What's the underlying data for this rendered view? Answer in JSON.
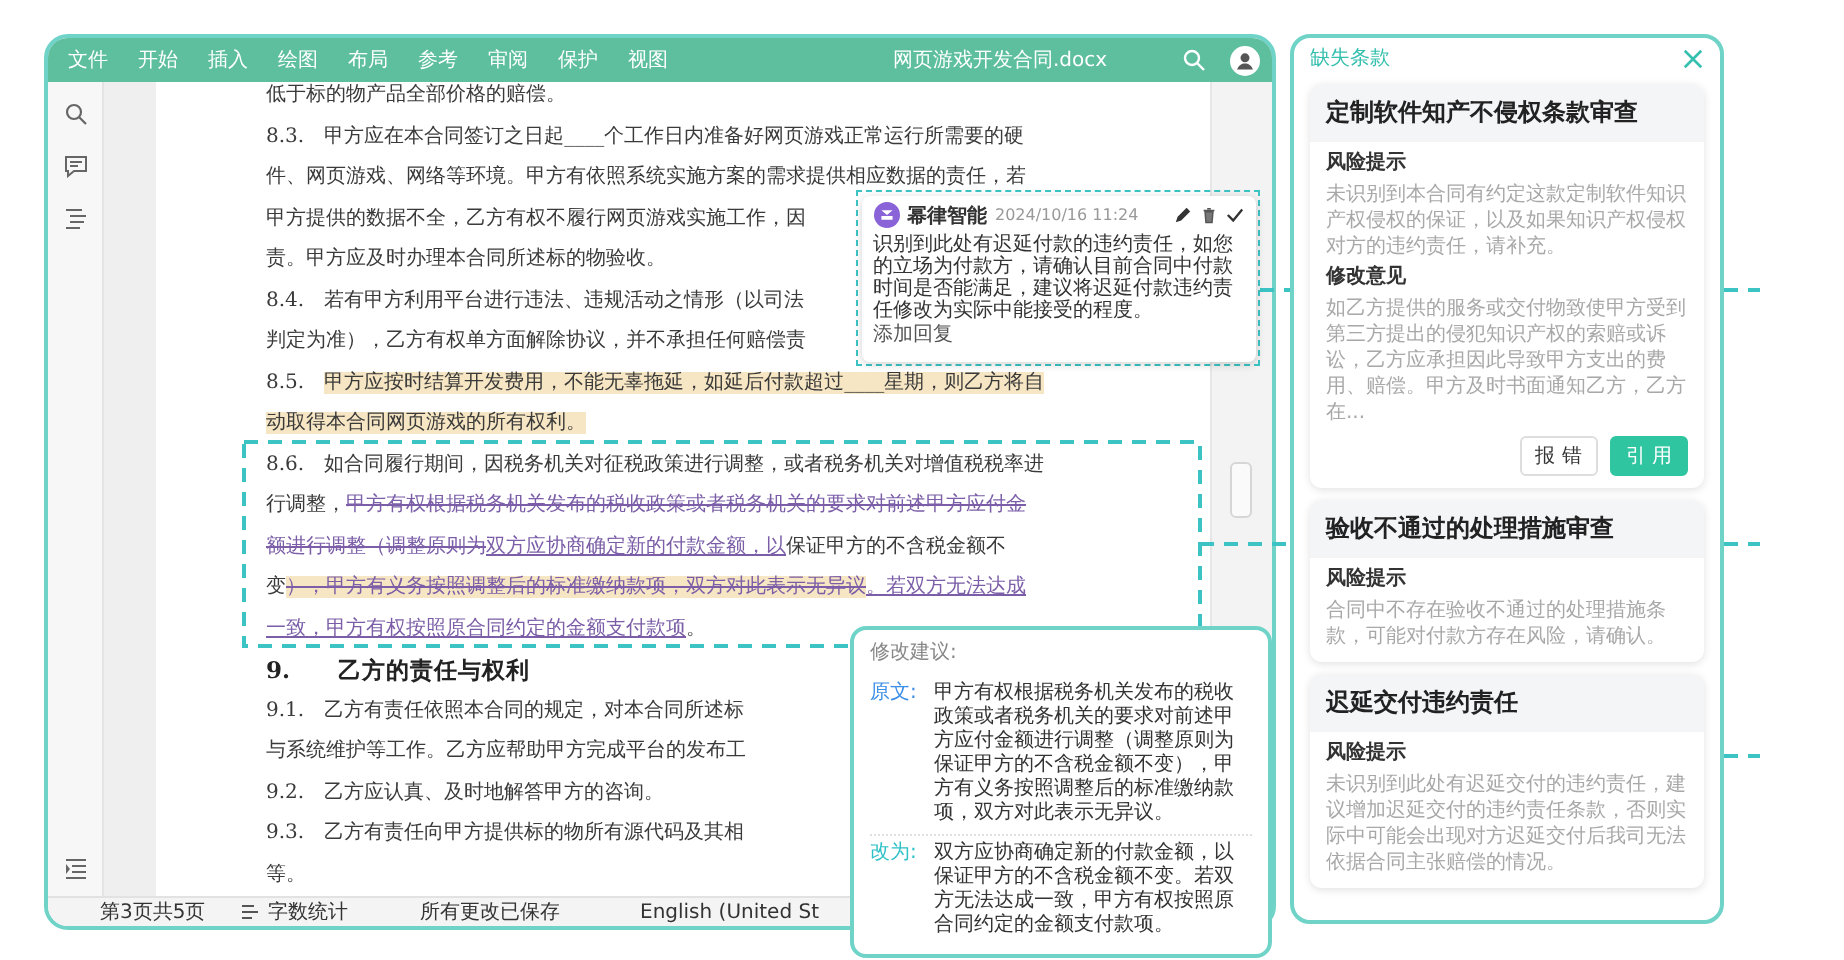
{
  "document_window": {
    "menu": [
      "文件",
      "开始",
      "插入",
      "绘图",
      "布局",
      "参考",
      "审阅",
      "保护",
      "视图"
    ],
    "title": "网页游戏开发合同.docx",
    "lines": [
      {
        "kind": "body",
        "segments": [
          {
            "text": "低于标的物产品全部价格的赔偿。",
            "kind": "plain",
            "highlighted": false
          }
        ]
      },
      {
        "kind": "body",
        "segments": [
          {
            "text": "8.3.　甲方应在本合同签订之日起____个工作日内准备好网页游戏正常运行所需要的硬",
            "kind": "plain",
            "highlighted": false
          }
        ]
      },
      {
        "kind": "body",
        "segments": [
          {
            "text": "件、网页游戏、网络等环境。甲方有依照系统实施方案的需求提供相应数据的责任，若",
            "kind": "plain",
            "highlighted": false
          }
        ]
      },
      {
        "kind": "body",
        "segments": [
          {
            "text": "甲方提供的数据不全，乙方有权不履行网页游戏实施工作，因",
            "kind": "plain",
            "highlighted": false
          }
        ]
      },
      {
        "kind": "body",
        "segments": [
          {
            "text": "责。甲方应及时办理本合同所述标的物验收。",
            "kind": "plain",
            "highlighted": false
          }
        ]
      },
      {
        "kind": "body",
        "segments": [
          {
            "text": "8.4.　若有甲方利用平台进行违法、违规活动之情形（以司法",
            "kind": "plain",
            "highlighted": false
          }
        ]
      },
      {
        "kind": "body",
        "segments": [
          {
            "text": "判定为准），乙方有权单方面解除协议，并不承担任何赔偿责",
            "kind": "plain",
            "highlighted": false
          }
        ]
      },
      {
        "kind": "body",
        "segments": [
          {
            "text": "8.5.　",
            "kind": "plain",
            "highlighted": false
          },
          {
            "text": "甲方应按时结算开发费用，不能无辜拖延，如延后付款超过____星期，则乙方将自",
            "kind": "plain",
            "highlighted": true
          }
        ]
      },
      {
        "kind": "body",
        "segments": [
          {
            "text": "动取得本合同网页游戏的所有权利。",
            "kind": "plain",
            "highlighted": true
          }
        ]
      },
      {
        "kind": "body",
        "segments": [
          {
            "text": "8.6.　如合同履行期间，因税务机关对征税政策进行调整，或者税务机关对增值税税率进",
            "kind": "plain",
            "highlighted": false
          }
        ]
      },
      {
        "kind": "body",
        "segments": [
          {
            "text": "行调整，",
            "kind": "plain",
            "highlighted": false
          },
          {
            "text": "甲方有权根据税务机关发布的税收政策或者税务机关的要求对前述甲方应付金",
            "kind": "deleted",
            "highlighted": false
          }
        ]
      },
      {
        "kind": "body",
        "segments": [
          {
            "text": "额进行调整（调整原则为",
            "kind": "deleted",
            "highlighted": false
          },
          {
            "text": "双方应协商确定新的付款金额，以",
            "kind": "inserted",
            "highlighted": false
          },
          {
            "text": "保证甲方的不含税金额不",
            "kind": "plain",
            "highlighted": false
          }
        ]
      },
      {
        "kind": "body",
        "segments": [
          {
            "text": "变",
            "kind": "plain",
            "highlighted": false
          },
          {
            "text": "），甲方有义务按照调整后的标准缴纳款项，双方对此表示无异议",
            "kind": "deleted",
            "highlighted": true
          },
          {
            "text": "。若双方无法达成",
            "kind": "inserted",
            "highlighted": false
          }
        ]
      },
      {
        "kind": "body",
        "segments": [
          {
            "text": "一致，甲方有权按照原合同约定的金额支付款项",
            "kind": "inserted",
            "highlighted": false
          },
          {
            "text": "。",
            "kind": "plain",
            "highlighted": false
          }
        ]
      },
      {
        "kind": "heading",
        "segments": [
          {
            "text": "9.　　乙方的责任与权利",
            "kind": "plain",
            "highlighted": false
          }
        ]
      },
      {
        "kind": "body",
        "segments": [
          {
            "text": "9.1.　乙方有责任依照本合同的规定，对本合同所述标",
            "kind": "plain",
            "highlighted": false
          }
        ]
      },
      {
        "kind": "body",
        "segments": [
          {
            "text": "与系统维护等工作。乙方应帮助甲方完成平台的发布工",
            "kind": "plain",
            "highlighted": false
          }
        ]
      },
      {
        "kind": "body",
        "segments": [
          {
            "text": "9.2.　乙方应认真、及时地解答甲方的咨询。",
            "kind": "plain",
            "highlighted": false
          }
        ]
      },
      {
        "kind": "body",
        "segments": [
          {
            "text": "9.3.　乙方有责任向甲方提供标的物所有源代码及其相",
            "kind": "plain",
            "highlighted": false
          }
        ]
      },
      {
        "kind": "body",
        "segments": [
          {
            "text": "等。",
            "kind": "plain",
            "highlighted": false
          }
        ]
      }
    ],
    "comment": {
      "author": "幂律智能",
      "time": "2024/10/16 11:24",
      "text": "识别到此处有迟延付款的违约责任，如您的立场为付款方，请确认目前合同中付款时间是否能满足，建议将迟延付款违约责任修改为实际中能接受的程度。",
      "reply_action": "添加回复"
    },
    "suggestion": {
      "title": "修改建议:",
      "items": [
        {
          "label": "原文:",
          "color": "#3a8ee6",
          "text": "甲方有权根据税务机关发布的税收政策或者税务机关的要求对前述甲方应付金额进行调整（调整原则为保证甲方的不含税金额不变），甲方有义务按照调整后的标准缴纳款项，双方对此表示无异议。"
        },
        {
          "label": "改为:",
          "color": "#2fc1c8",
          "text": "双方应协商确定新的付款金额，以保证甲方的不含税金额不变。若双方无法达成一致，甲方有权按照原合同约定的金额支付款项。"
        }
      ]
    },
    "status_bar": {
      "page": "第3页共5页",
      "word_count": "字数统计",
      "save_status": "所有更改已保存",
      "language": "English (United St"
    }
  },
  "panel": {
    "title": "缺失条款",
    "cards": [
      {
        "title": "定制软件知产不侵权条款审查",
        "sections": [
          {
            "heading": "风险提示",
            "text": "未识别到本合同有约定这款定制软件知识产权侵权的保证，以及如果知识产权侵权对方的违约责任，请补充。"
          },
          {
            "heading": "修改意见",
            "text": "如乙方提供的服务或交付物致使甲方受到第三方提出的侵犯知识产权的索赔或诉讼，乙方应承担因此导致甲方支出的费用、赔偿。甲方及时书面通知乙方，乙方在..."
          }
        ],
        "buttons": [
          {
            "label": "报 错",
            "kind": "secondary"
          },
          {
            "label": "引 用",
            "kind": "primary"
          }
        ]
      },
      {
        "title": "验收不通过的处理措施审查",
        "sections": [
          {
            "heading": "风险提示",
            "text": "合同中不存在验收不通过的处理措施条款，可能对付款方存在风险，请确认。"
          }
        ]
      },
      {
        "title": "迟延交付违约责任",
        "sections": [
          {
            "heading": "风险提示",
            "text": "未识别到此处有迟延交付的违约责任，建议增加迟延交付的违约责任条款，否则实际中可能会出现对方迟延交付后我司无法依据合同主张赔偿的情况。"
          }
        ]
      }
    ]
  }
}
